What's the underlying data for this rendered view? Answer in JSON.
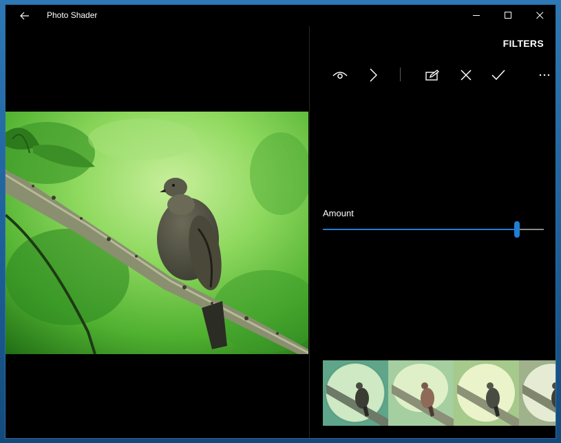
{
  "window": {
    "title": "Photo Shader"
  },
  "panel": {
    "title": "FILTERS"
  },
  "toolbar": {
    "items": [
      {
        "name": "eye-icon"
      },
      {
        "name": "chevron-right-icon"
      },
      {
        "name": "edit-icon"
      },
      {
        "name": "close-icon"
      },
      {
        "name": "check-icon"
      },
      {
        "name": "more-icon"
      }
    ]
  },
  "amount": {
    "label": "Amount",
    "value": 0.88
  },
  "colors": {
    "accent": "#1f7fd6",
    "background": "#000000"
  },
  "filters": {
    "thumbnails": [
      {
        "name": "filter-thumb-1"
      },
      {
        "name": "filter-thumb-2"
      },
      {
        "name": "filter-thumb-3"
      },
      {
        "name": "filter-thumb-4"
      }
    ]
  }
}
